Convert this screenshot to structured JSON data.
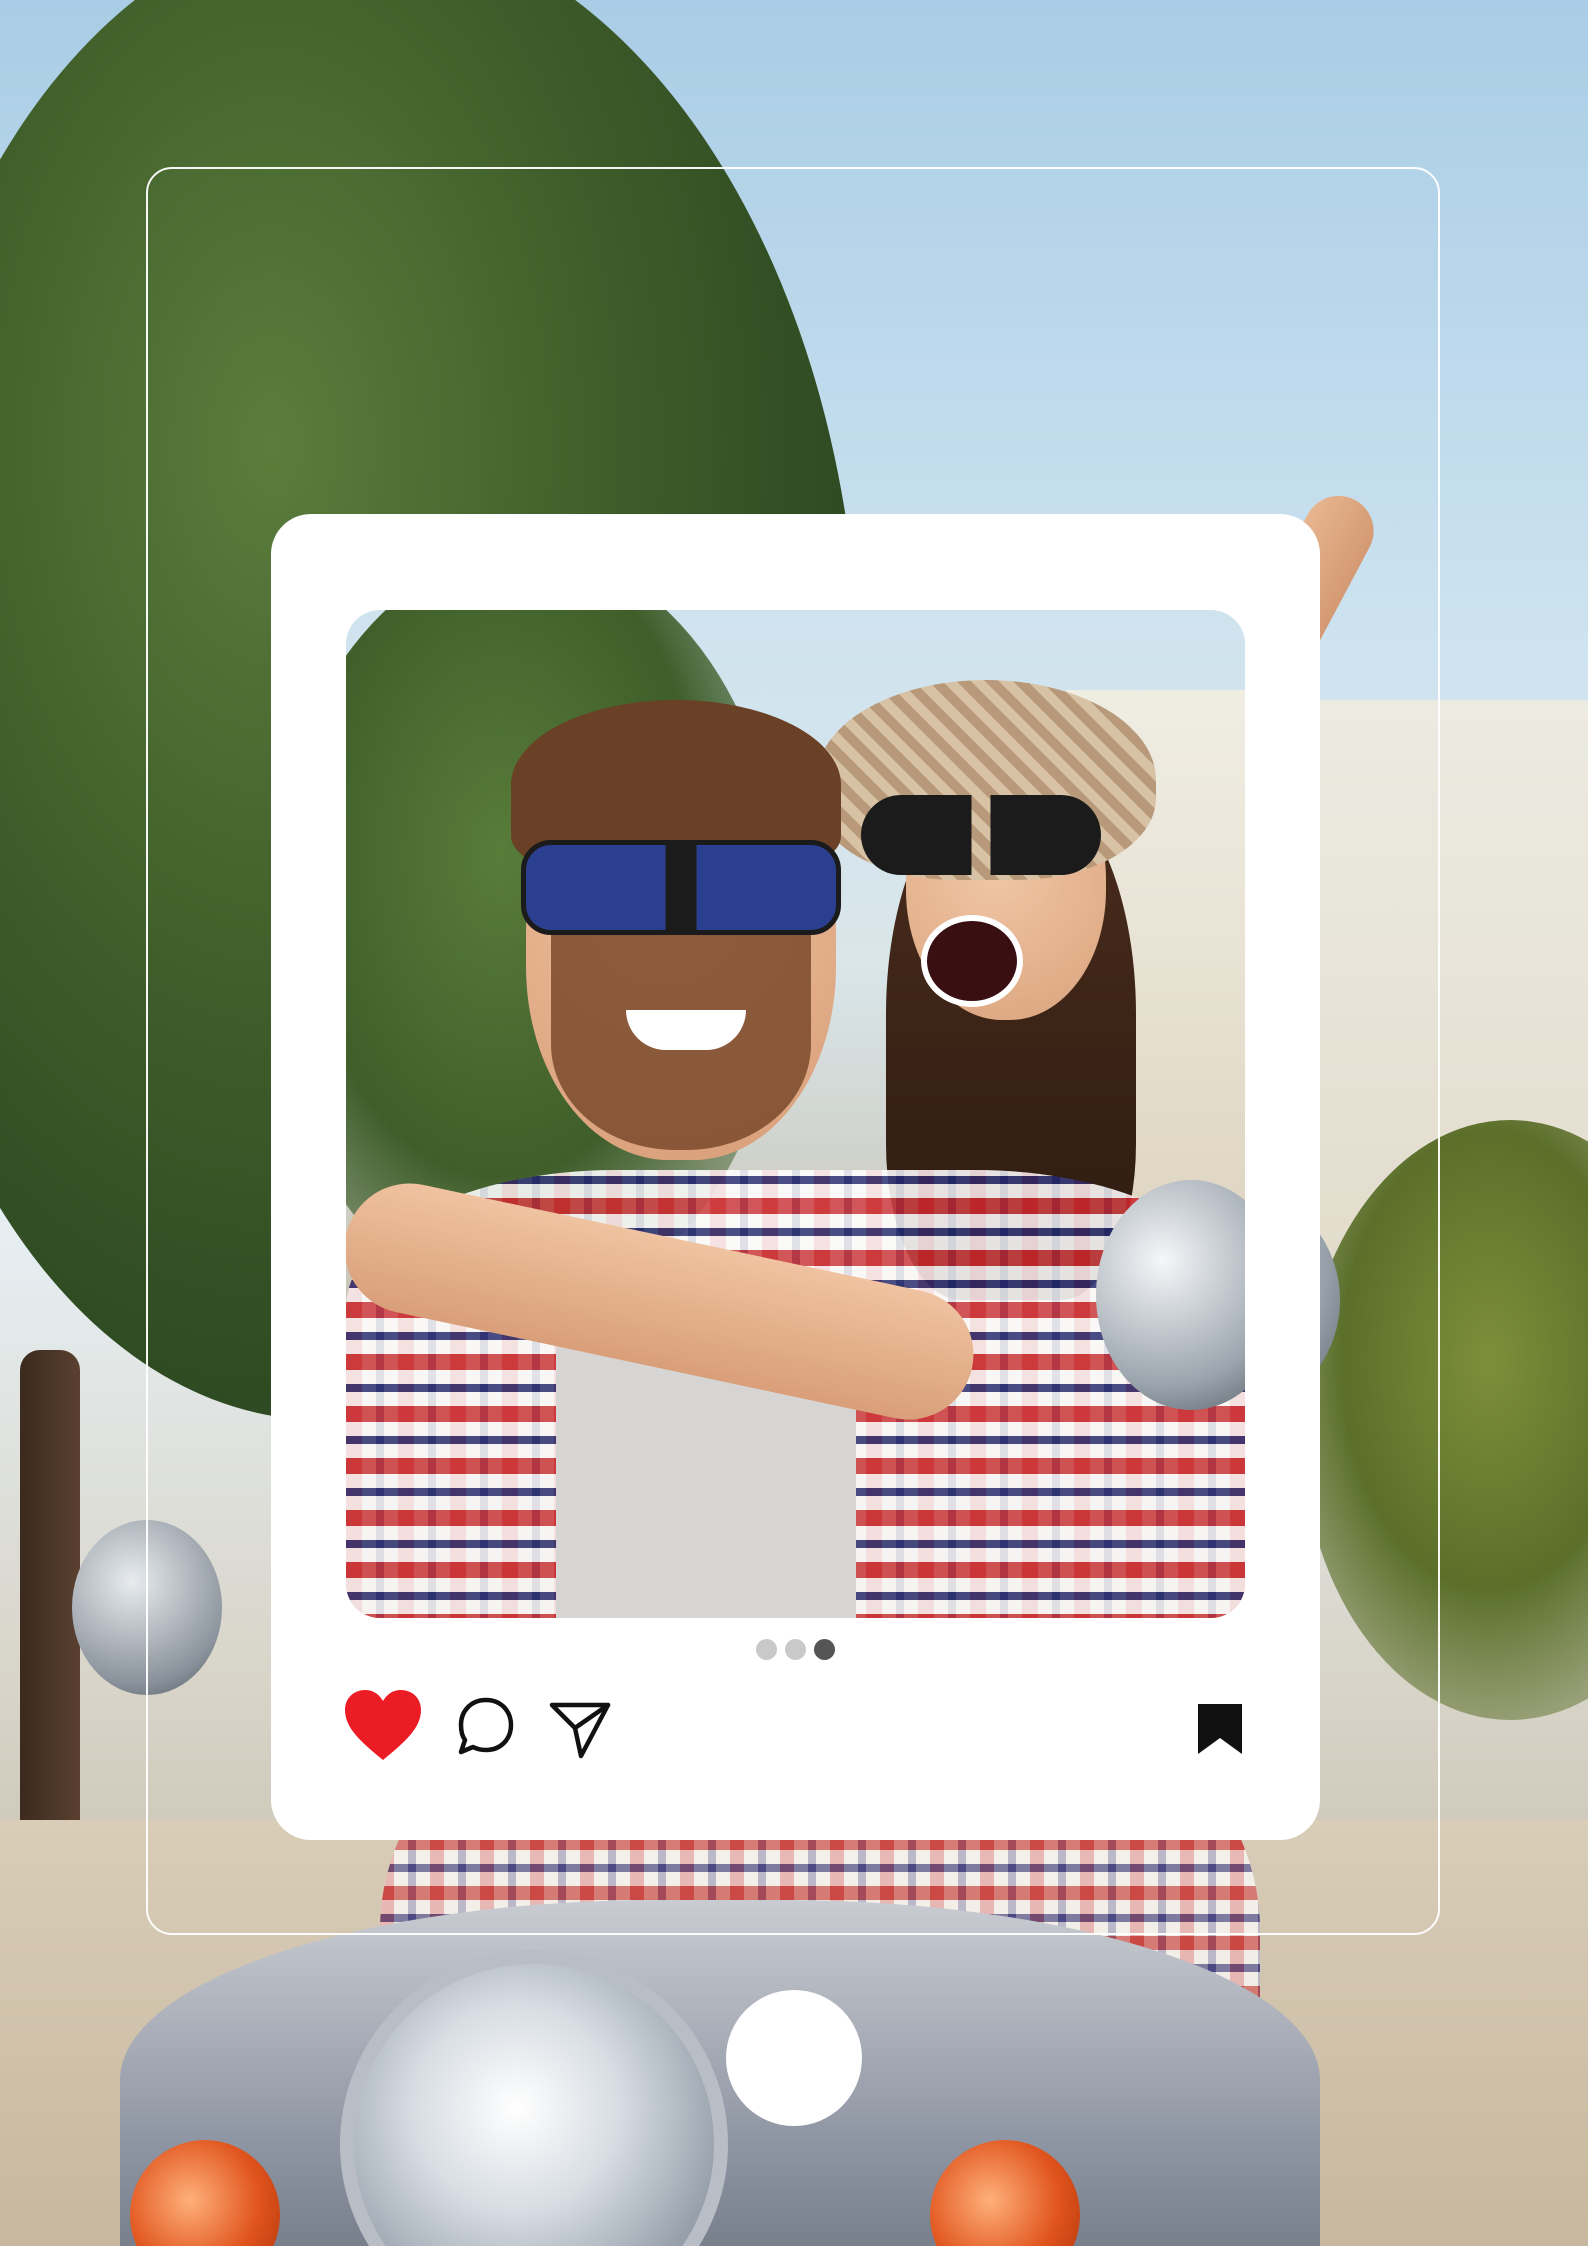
{
  "post": {
    "carousel": {
      "total": 3,
      "active_index": 3
    },
    "actions": {
      "like": {
        "icon": "heart-filled-icon",
        "state": "liked",
        "color": "#ec1c24"
      },
      "comment": {
        "icon": "comment-bubble-icon"
      },
      "share": {
        "icon": "paper-plane-icon"
      },
      "save": {
        "icon": "bookmark-filled-icon"
      }
    }
  },
  "colors": {
    "card_background": "#ffffff",
    "frame_stroke": "#ffffff",
    "like_red": "#ec1c24",
    "icon_black": "#111111",
    "dot_inactive": "#c9c9c9",
    "dot_active": "#555555"
  },
  "capture": {
    "icon": "shutter-button"
  }
}
